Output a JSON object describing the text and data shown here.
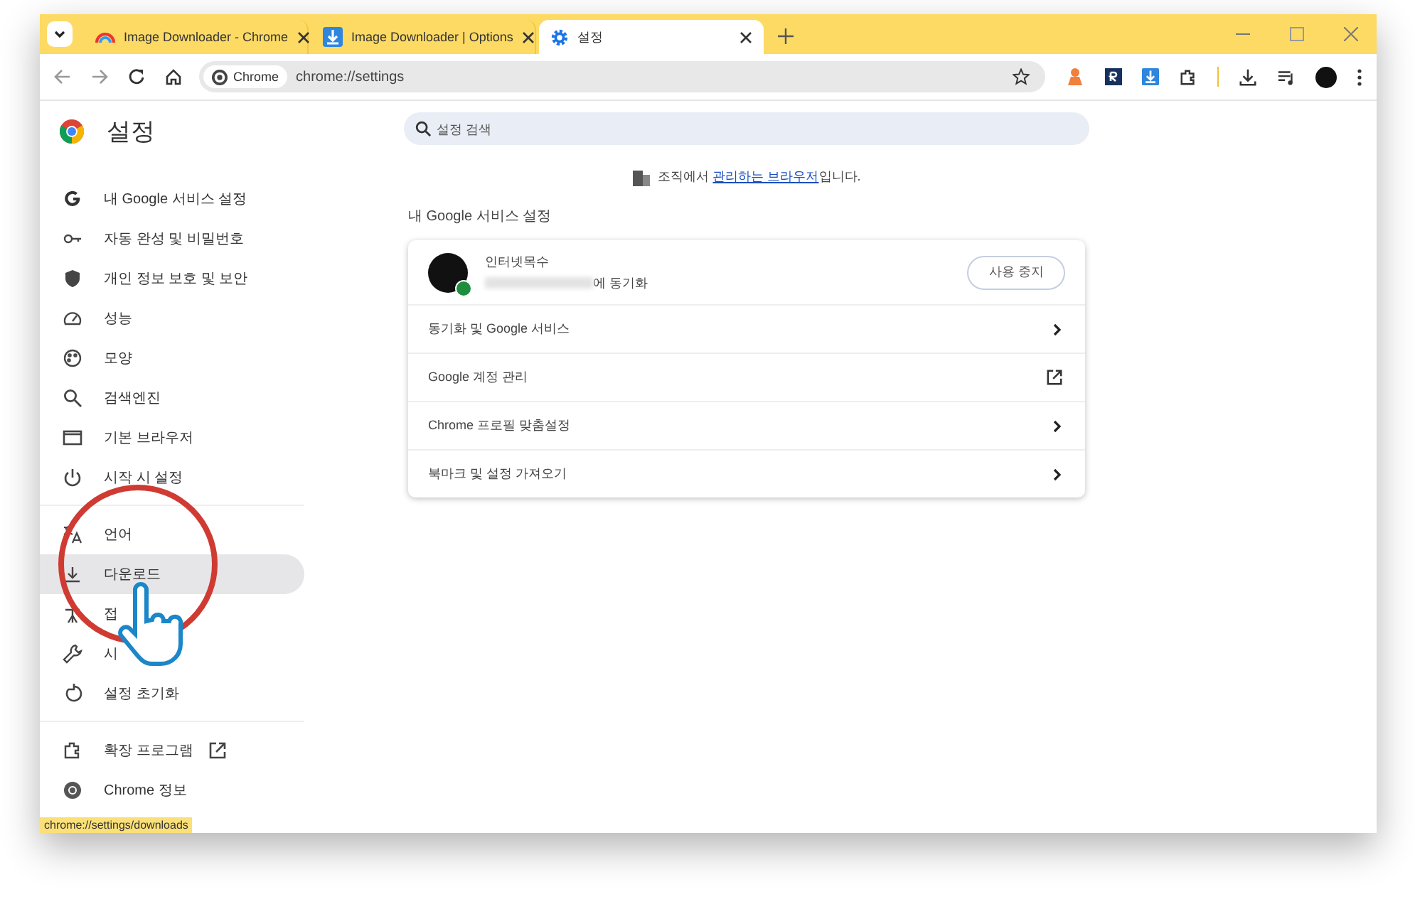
{
  "tabs": [
    {
      "kind": "rainbow",
      "title": "Image Downloader - Chrome",
      "selected": false
    },
    {
      "kind": "download",
      "title": "Image Downloader | Options",
      "selected": false
    },
    {
      "kind": "gear",
      "title": "설정",
      "selected": true
    }
  ],
  "toolbar": {
    "site_chip": "Chrome",
    "url": "chrome://settings"
  },
  "sidebar": {
    "title": "설정",
    "groups": [
      [
        {
          "label": "내 Google 서비스 설정",
          "selected": false
        },
        {
          "label": "자동 완성 및 비밀번호",
          "selected": false
        },
        {
          "label": "개인 정보 보호 및 보안",
          "selected": false
        },
        {
          "label": "성능",
          "selected": false
        },
        {
          "label": "모양",
          "selected": false
        },
        {
          "label": "검색엔진",
          "selected": false
        },
        {
          "label": "기본 브라우저",
          "selected": false
        },
        {
          "label": "시작 시 설정",
          "selected": false
        }
      ],
      [
        {
          "label": "언어",
          "selected": false
        },
        {
          "label": "다운로드",
          "selected": true
        },
        {
          "label": "접",
          "selected": false
        },
        {
          "label": "시",
          "selected": false
        },
        {
          "label": "설정 초기화",
          "selected": false
        }
      ],
      [
        {
          "label": "확장 프로그램",
          "selected": false,
          "external": true
        },
        {
          "label": "Chrome 정보",
          "selected": false
        }
      ]
    ]
  },
  "search": {
    "placeholder": "설정 검색"
  },
  "managed_notice": {
    "before": "조직에서 ",
    "link": "관리하는 브라우저",
    "after": "입니다."
  },
  "section_title": "내 Google 서비스 설정",
  "profile": {
    "name": "인터넷목수",
    "sync_suffix": "에 동기화",
    "button": "사용 중지"
  },
  "rows": [
    {
      "label": "동기화 및 Google 서비스",
      "kind": "chevron"
    },
    {
      "label": "Google 계정 관리",
      "kind": "external"
    },
    {
      "label": "Chrome 프로필 맞춤설정",
      "kind": "chevron"
    },
    {
      "label": "북마크 및 설정 가져오기",
      "kind": "chevron"
    }
  ],
  "status_bubble": "chrome://settings/downloads"
}
